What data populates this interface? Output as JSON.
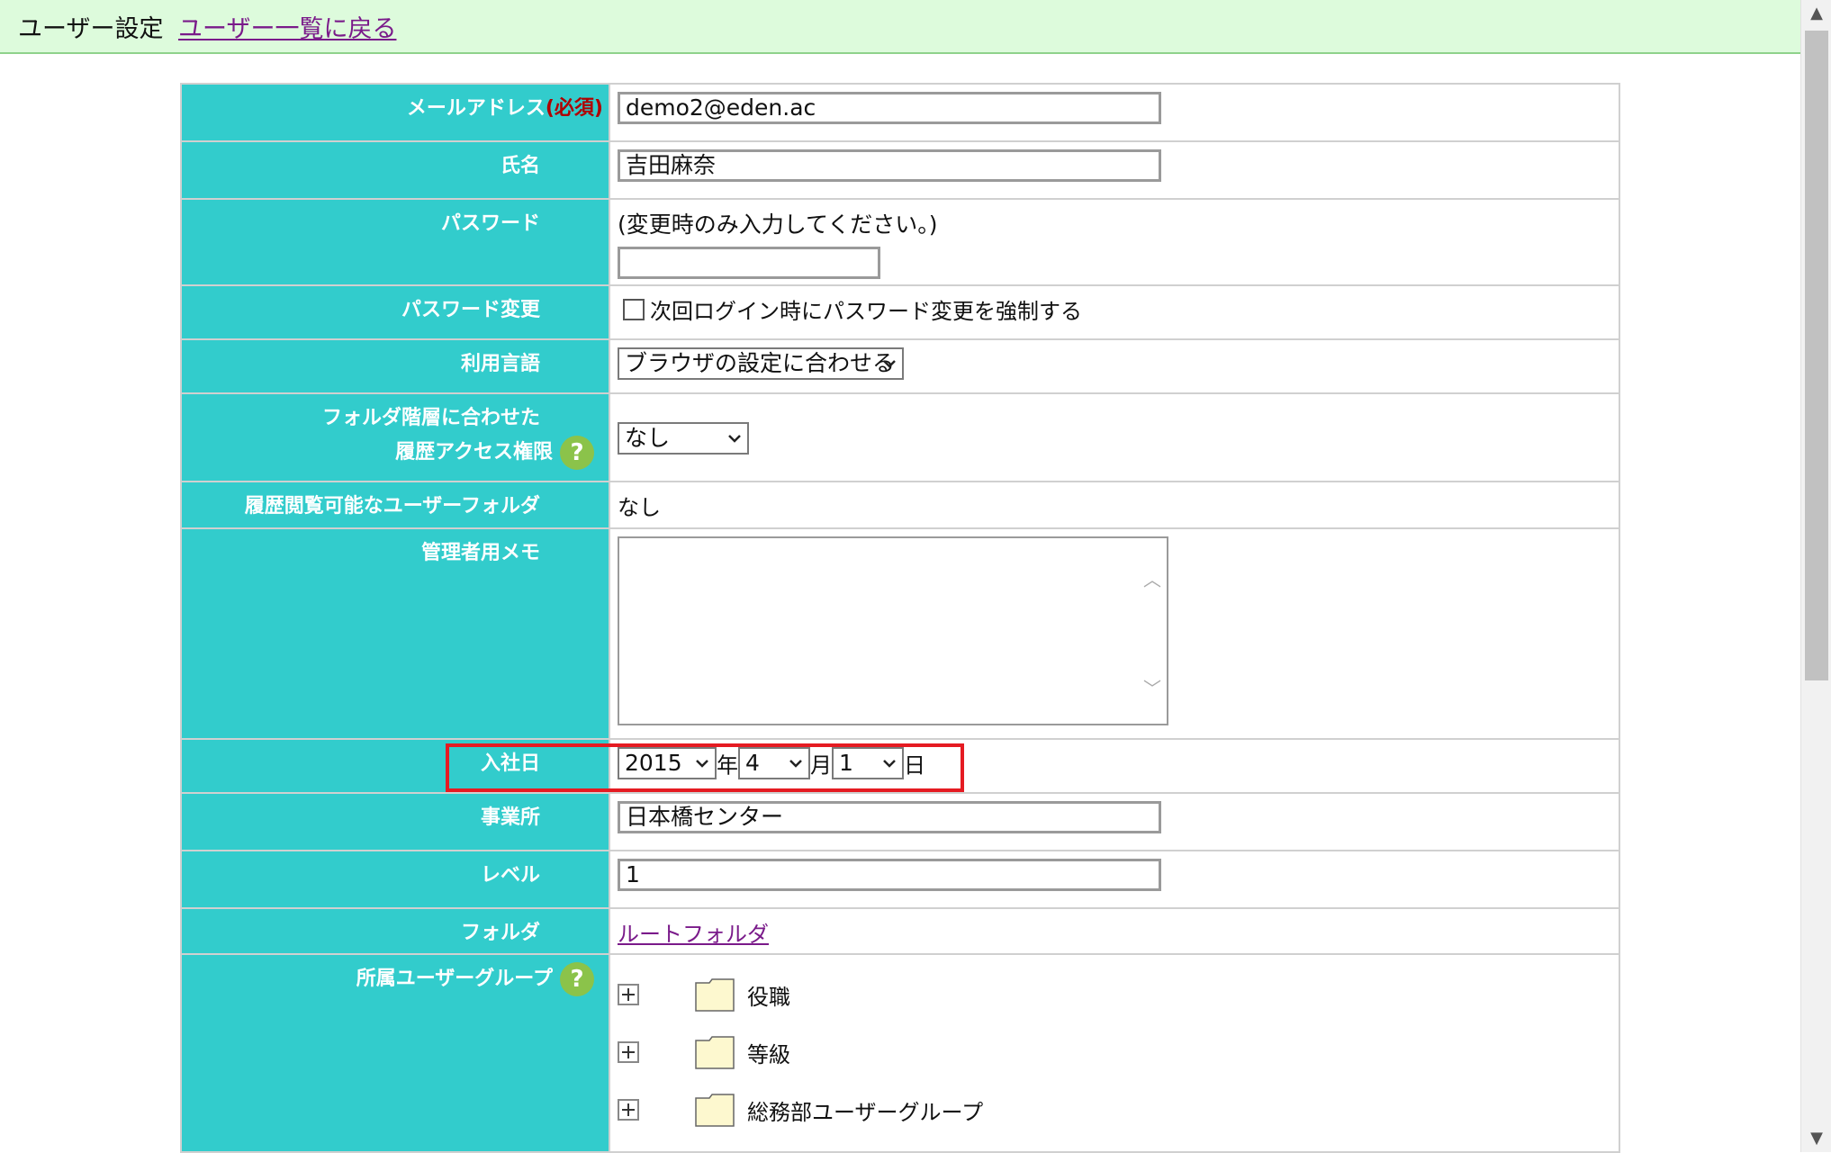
{
  "header": {
    "title": "ユーザー設定",
    "back_link": "ユーザー一覧に戻る"
  },
  "form": {
    "email": {
      "label": "メールアドレス",
      "required": "(必須)",
      "value": "demo2@eden.ac"
    },
    "name": {
      "label": "氏名",
      "value": "吉田麻奈"
    },
    "password": {
      "label": "パスワード",
      "note": "(変更時のみ入力してください。)",
      "value": ""
    },
    "password_change": {
      "label": "パスワード変更",
      "checkbox_label": "次回ログイン時にパスワード変更を強制する",
      "checked": false
    },
    "language": {
      "label": "利用言語",
      "selected": "ブラウザの設定に合わせる"
    },
    "history_access": {
      "label_line1": "フォルダ階層に合わせた",
      "label_line2": "履歴アクセス権限",
      "selected": "なし"
    },
    "viewable_user_folder": {
      "label": "履歴閲覧可能なユーザーフォルダ",
      "value": "なし"
    },
    "admin_memo": {
      "label": "管理者用メモ",
      "value": ""
    },
    "hire_date": {
      "label": "入社日",
      "year": "2015",
      "year_unit": "年",
      "month": "4",
      "month_unit": "月",
      "day": "1",
      "day_unit": "日"
    },
    "office": {
      "label": "事業所",
      "value": "日本橋センター"
    },
    "level": {
      "label": "レベル",
      "value": "1"
    },
    "folder": {
      "label": "フォルダ",
      "link": "ルートフォルダ"
    },
    "user_groups": {
      "label": "所属ユーザーグループ",
      "items": [
        {
          "name": "役職"
        },
        {
          "name": "等級"
        },
        {
          "name": "総務部ユーザーグループ"
        }
      ]
    }
  },
  "icons": {
    "help": "?",
    "scroll_up": "▲",
    "scroll_down": "▼",
    "memo_up": "︿",
    "memo_down": "﹀"
  },
  "colors": {
    "label_bg": "#32cccc",
    "header_bg": "#ddfbdc",
    "highlight": "#e51b22",
    "link": "#7a1a8a",
    "required": "#b00000",
    "help": "#8bc34a"
  }
}
